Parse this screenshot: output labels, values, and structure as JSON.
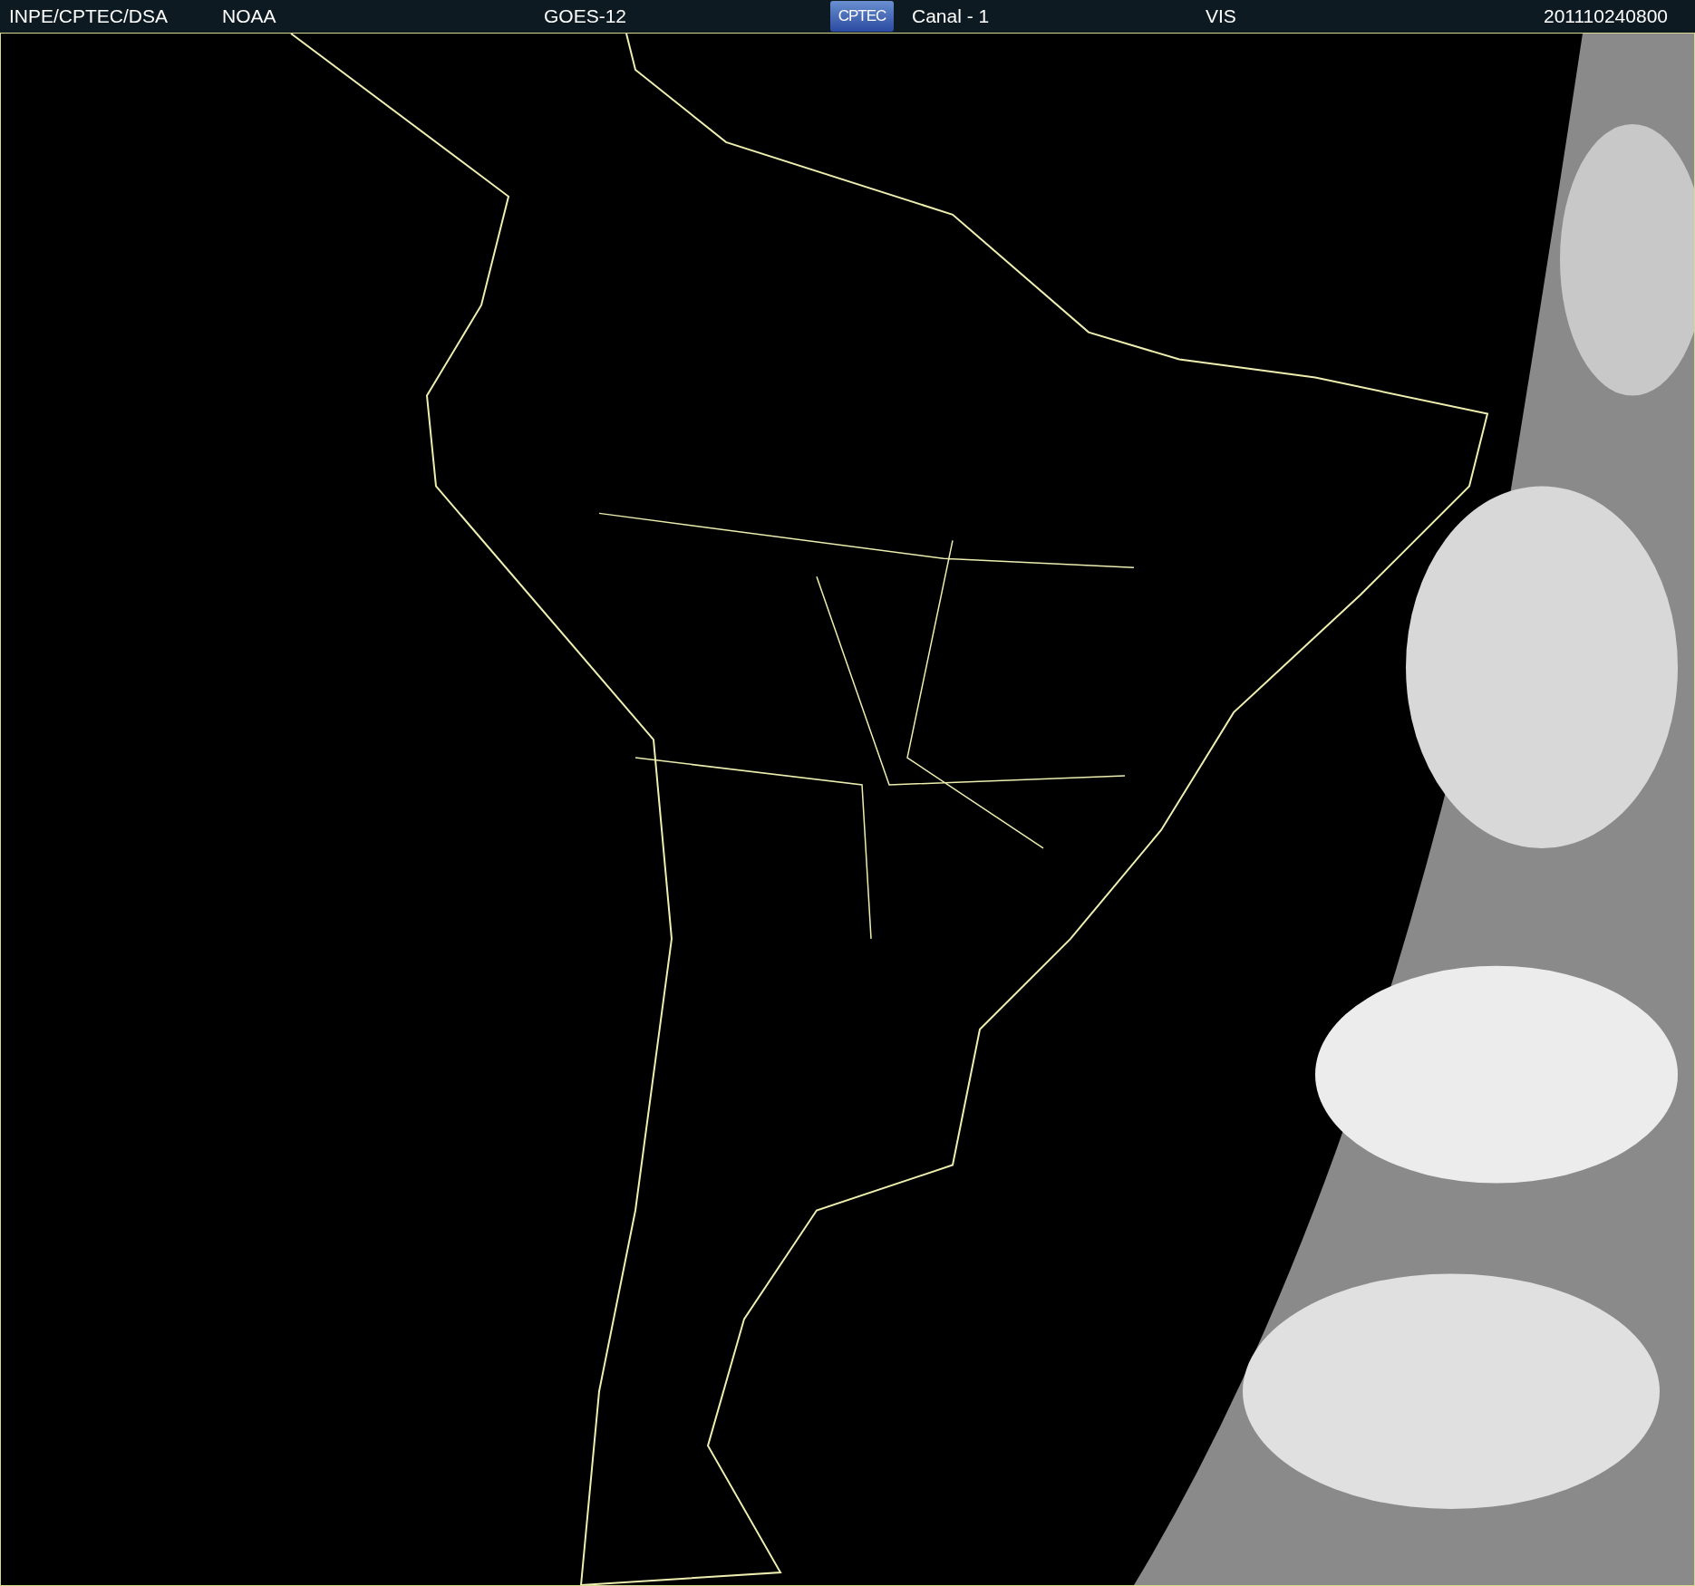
{
  "header": {
    "items": [
      "INPE/CPTEC/DSA",
      "NOAA",
      "GOES-12"
    ],
    "logo": "CPTEC",
    "items_after": [
      "Canal - 1",
      "VIS",
      "201110240800"
    ]
  }
}
